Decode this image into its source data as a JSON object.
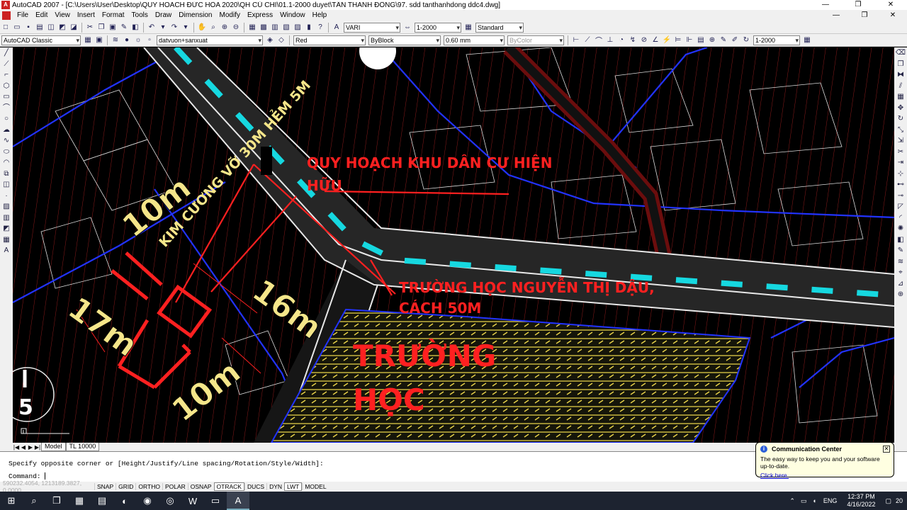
{
  "window": {
    "title": "AutoCAD 2007 - [C:\\Users\\User\\Desktop\\QUY HOACH ĐỨC HÒA 2020\\QH CỦ CHI\\01.1-2000 duyet\\TÂN THANH ĐÔNG\\97. sdd tanthanhdong ddc4.dwg]",
    "app_icon": "A",
    "minimize": "—",
    "maximize": "❐",
    "close": "✕"
  },
  "menubar": {
    "items": [
      "File",
      "Edit",
      "View",
      "Insert",
      "Format",
      "Tools",
      "Draw",
      "Dimension",
      "Modify",
      "Express",
      "Window",
      "Help"
    ],
    "mdi_min": "—",
    "mdi_max": "❐",
    "mdi_close": "✕"
  },
  "toolbar1": {
    "text_style": "VARI",
    "dim_style": "1-2000",
    "table_style": "Standard"
  },
  "toolbar2": {
    "workspace": "AutoCAD Classic",
    "layer": "datvuon+sanxuat",
    "color": "Red",
    "linetype": "ByBlock",
    "lineweight": "0.60 mm",
    "plotstyle": "ByColor",
    "scale": "1-2000"
  },
  "drawing": {
    "annotations": {
      "planning_title_1": "QUY HOẠCH KHU DÂN CƯ HIỆN",
      "planning_title_2": "HỮU",
      "road_label": "KIM CƯƠNG VỠ 30M HẺM 5M",
      "school_distance_1": "TRƯỜNG HỌC NGUYỄN THỊ DẬU,",
      "school_distance_2": "CÁCH 50M",
      "school_1": "TRƯỜNG",
      "school_2": "HỌC",
      "dim_top": "10m",
      "dim_right": "16m",
      "dim_left": "17m",
      "dim_bottom": "10m",
      "circle_top": "3",
      "circle_bottom": "5"
    }
  },
  "tabs": {
    "nav": [
      "|◀",
      "◀",
      "▶",
      "▶|"
    ],
    "model": "Model",
    "layout": "TL 10000"
  },
  "command": {
    "history": "Specify opposite corner or [Height/Justify/Line spacing/Rotation/Style/Width]:",
    "prompt": "Command:"
  },
  "status": {
    "coords": "590232.4054, 1213189.3827, 0.0000",
    "buttons": [
      {
        "label": "SNAP",
        "on": false
      },
      {
        "label": "GRID",
        "on": false
      },
      {
        "label": "ORTHO",
        "on": false
      },
      {
        "label": "POLAR",
        "on": false
      },
      {
        "label": "OSNAP",
        "on": false
      },
      {
        "label": "OTRACK",
        "on": true
      },
      {
        "label": "DUCS",
        "on": false
      },
      {
        "label": "DYN",
        "on": false
      },
      {
        "label": "LWT",
        "on": true
      },
      {
        "label": "MODEL",
        "on": false
      }
    ]
  },
  "balloon": {
    "title": "Communication Center",
    "body": "The easy way to keep you and your software up-to-date.",
    "link": "Click here.",
    "close": "✕",
    "icon": "i"
  },
  "taskbar": {
    "lang": "ENG",
    "time": "12:37 PM",
    "date": "4/16/2022",
    "notification_count": "20"
  },
  "colors": {
    "road_dash": "#16d8e0",
    "annotation_red": "#ff2020",
    "annotation_yellow": "#f5e68a",
    "hatch_yellow": "#e8d34a",
    "parcel_blue": "#2233ff"
  }
}
